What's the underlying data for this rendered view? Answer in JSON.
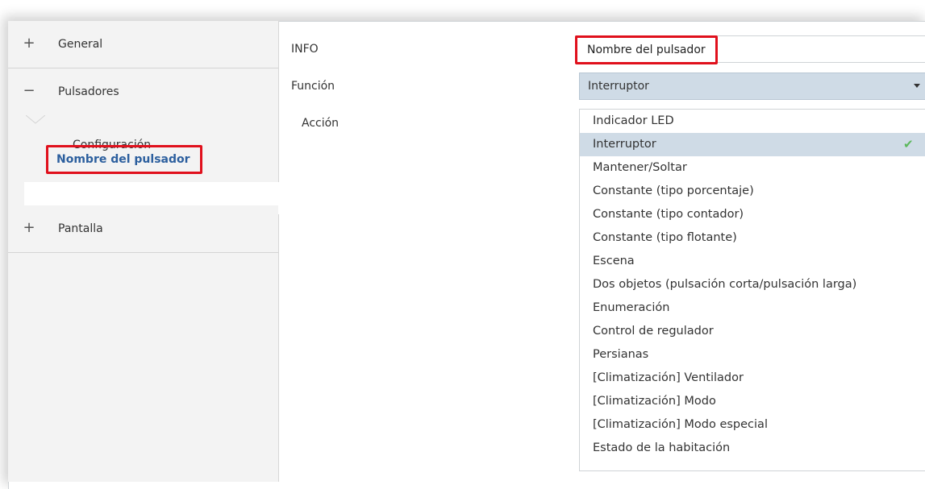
{
  "sidebar": {
    "items": [
      {
        "sign": "+",
        "label": "General"
      },
      {
        "sign": "−",
        "label": "Pulsadores"
      },
      {
        "sign": "+",
        "label": "Pantalla"
      }
    ],
    "sub_items": [
      {
        "label": "Configuración"
      },
      {
        "label": "Nombre del pulsador"
      }
    ]
  },
  "main": {
    "info_label": "INFO",
    "info_value": "Nombre del pulsador",
    "funcion_label": "Función",
    "accion_label": "Acción",
    "funcion_value": "Interruptor",
    "dropdown_options": [
      "Indicador LED",
      "Interruptor",
      "Mantener/Soltar",
      "Constante (tipo porcentaje)",
      "Constante (tipo contador)",
      "Constante (tipo flotante)",
      "Escena",
      "Dos objetos (pulsación corta/pulsación larga)",
      "Enumeración",
      "Control de regulador",
      "Persianas",
      "[Climatización] Ventilador",
      "[Climatización] Modo",
      "[Climatización] Modo especial",
      "Estado de la habitación"
    ],
    "selected_option": "Interruptor",
    "check_glyph": "✔"
  },
  "colors": {
    "highlight_border": "#e0101c",
    "selected_bg": "#cfdbe6",
    "selected_text": "#2c5f9e",
    "check": "#5cb85c"
  }
}
